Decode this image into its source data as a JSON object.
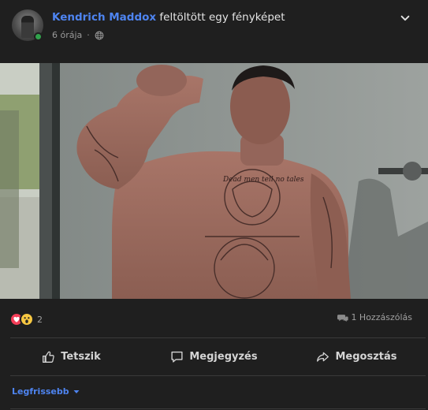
{
  "post": {
    "author": "Kendrich Maddox",
    "action": "feltöltött egy fényképet",
    "time": "6 órája",
    "separator": "·"
  },
  "reactions": {
    "count": "2",
    "types": [
      "love",
      "wow"
    ]
  },
  "comments": {
    "label": "1 Hozzászólás"
  },
  "actions": {
    "like": "Tetszik",
    "comment": "Megjegyzés",
    "share": "Megosztás"
  },
  "sort": {
    "label": "Legfrissebb"
  },
  "photo": {
    "tattoo_text": "Dead men tell no tales"
  },
  "colors": {
    "accent": "#4e84f0",
    "background": "#1f1f1f",
    "love": "#f33e58",
    "wow": "#f7c842",
    "online": "#31a24c"
  }
}
